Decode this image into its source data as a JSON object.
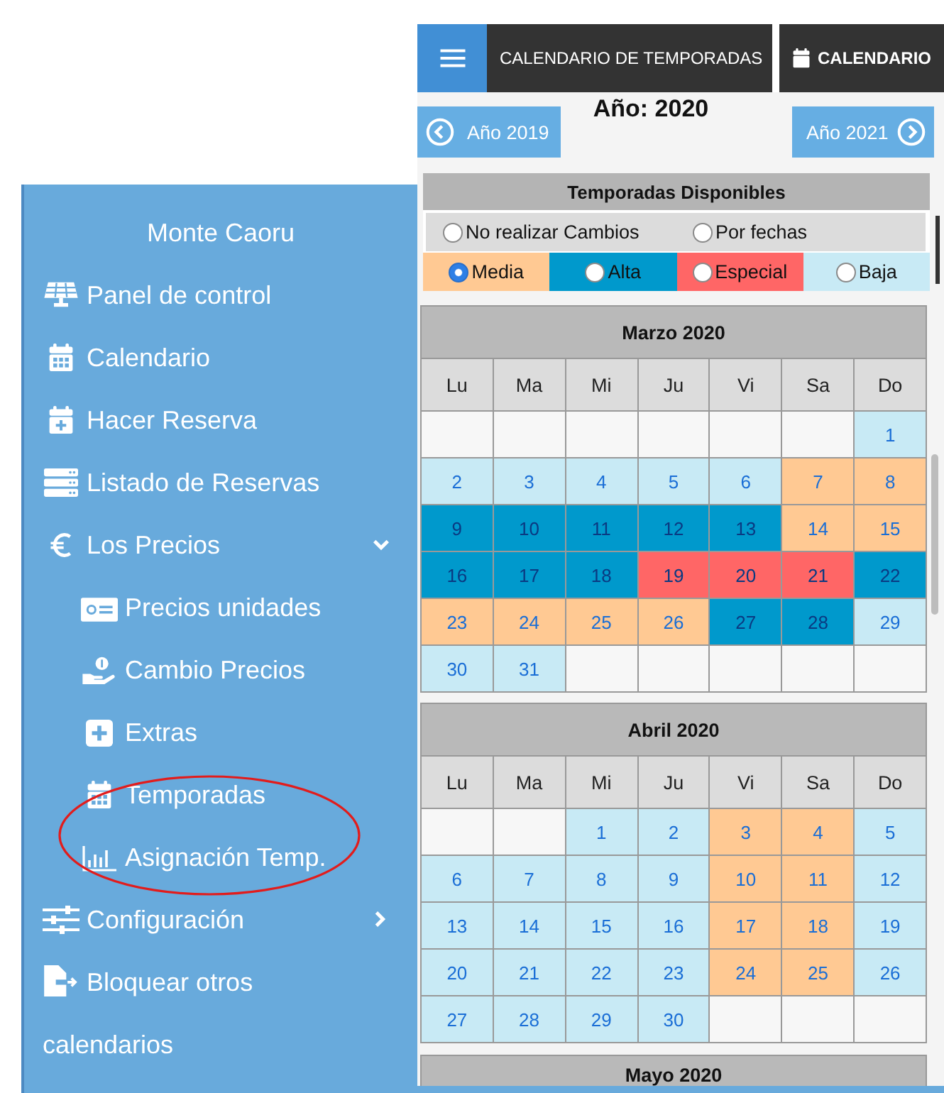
{
  "header": {
    "title": "CALENDARIO DE TEMPORADAS",
    "calendar_button": "CALENDARIO"
  },
  "year_nav": {
    "year": "Año: 2020",
    "previous": "Año 2019",
    "next": "Año 2021"
  },
  "season_panel": {
    "title": "Temporadas Disponibles",
    "modes": [
      {
        "label": "No realizar Cambios",
        "selected": false
      },
      {
        "label": "Por fechas",
        "selected": false
      }
    ],
    "seasons": [
      {
        "label": "Media",
        "color": "#ffc993",
        "selected": true
      },
      {
        "label": "Alta",
        "color": "#0099cc",
        "selected": false
      },
      {
        "label": "Especial",
        "color": "#ff6666",
        "selected": false
      },
      {
        "label": "Baja",
        "color": "#c8eaf5",
        "selected": false
      }
    ]
  },
  "months": [
    {
      "title": "Marzo 2020",
      "weekdays": [
        "Lu",
        "Ma",
        "Mi",
        "Ju",
        "Vi",
        "Sa",
        "Do"
      ],
      "weeks": [
        [
          {
            "kind": "blank"
          },
          {
            "kind": "blank"
          },
          {
            "kind": "blank"
          },
          {
            "kind": "blank"
          },
          {
            "kind": "blank"
          },
          {
            "kind": "blank"
          },
          {
            "kind": "day",
            "day": "1",
            "color": "#c8eaf5"
          }
        ],
        [
          {
            "kind": "day",
            "day": "2",
            "color": "#c8eaf5"
          },
          {
            "kind": "day",
            "day": "3",
            "color": "#c8eaf5"
          },
          {
            "kind": "day",
            "day": "4",
            "color": "#c8eaf5"
          },
          {
            "kind": "day",
            "day": "5",
            "color": "#c8eaf5"
          },
          {
            "kind": "day",
            "day": "6",
            "color": "#c8eaf5"
          },
          {
            "kind": "day",
            "day": "7",
            "color": "#ffc993"
          },
          {
            "kind": "day",
            "day": "8",
            "color": "#ffc993"
          }
        ],
        [
          {
            "kind": "day",
            "day": "9",
            "color": "#0099cc"
          },
          {
            "kind": "day",
            "day": "10",
            "color": "#0099cc"
          },
          {
            "kind": "day",
            "day": "11",
            "color": "#0099cc"
          },
          {
            "kind": "day",
            "day": "12",
            "color": "#0099cc"
          },
          {
            "kind": "day",
            "day": "13",
            "color": "#0099cc"
          },
          {
            "kind": "day",
            "day": "14",
            "color": "#ffc993"
          },
          {
            "kind": "day",
            "day": "15",
            "color": "#ffc993"
          }
        ],
        [
          {
            "kind": "day",
            "day": "16",
            "color": "#0099cc"
          },
          {
            "kind": "day",
            "day": "17",
            "color": "#0099cc"
          },
          {
            "kind": "day",
            "day": "18",
            "color": "#0099cc"
          },
          {
            "kind": "day",
            "day": "19",
            "color": "#ff6666"
          },
          {
            "kind": "day",
            "day": "20",
            "color": "#ff6666"
          },
          {
            "kind": "day",
            "day": "21",
            "color": "#ff6666"
          },
          {
            "kind": "day",
            "day": "22",
            "color": "#0099cc"
          }
        ],
        [
          {
            "kind": "day",
            "day": "23",
            "color": "#ffc993"
          },
          {
            "kind": "day",
            "day": "24",
            "color": "#ffc993"
          },
          {
            "kind": "day",
            "day": "25",
            "color": "#ffc993"
          },
          {
            "kind": "day",
            "day": "26",
            "color": "#ffc993"
          },
          {
            "kind": "day",
            "day": "27",
            "color": "#0099cc"
          },
          {
            "kind": "day",
            "day": "28",
            "color": "#0099cc"
          },
          {
            "kind": "day",
            "day": "29",
            "color": "#c8eaf5"
          }
        ],
        [
          {
            "kind": "day",
            "day": "30",
            "color": "#c8eaf5"
          },
          {
            "kind": "day",
            "day": "31",
            "color": "#c8eaf5"
          },
          {
            "kind": "blank"
          },
          {
            "kind": "blank"
          },
          {
            "kind": "blank"
          },
          {
            "kind": "blank"
          },
          {
            "kind": "blank"
          }
        ]
      ]
    },
    {
      "title": "Abril 2020",
      "weekdays": [
        "Lu",
        "Ma",
        "Mi",
        "Ju",
        "Vi",
        "Sa",
        "Do"
      ],
      "weeks": [
        [
          {
            "kind": "blank"
          },
          {
            "kind": "blank"
          },
          {
            "kind": "day",
            "day": "1",
            "color": "#c8eaf5"
          },
          {
            "kind": "day",
            "day": "2",
            "color": "#c8eaf5"
          },
          {
            "kind": "day",
            "day": "3",
            "color": "#ffc993"
          },
          {
            "kind": "day",
            "day": "4",
            "color": "#ffc993"
          },
          {
            "kind": "day",
            "day": "5",
            "color": "#c8eaf5"
          }
        ],
        [
          {
            "kind": "day",
            "day": "6",
            "color": "#c8eaf5"
          },
          {
            "kind": "day",
            "day": "7",
            "color": "#c8eaf5"
          },
          {
            "kind": "day",
            "day": "8",
            "color": "#c8eaf5"
          },
          {
            "kind": "day",
            "day": "9",
            "color": "#c8eaf5"
          },
          {
            "kind": "day",
            "day": "10",
            "color": "#ffc993"
          },
          {
            "kind": "day",
            "day": "11",
            "color": "#ffc993"
          },
          {
            "kind": "day",
            "day": "12",
            "color": "#c8eaf5"
          }
        ],
        [
          {
            "kind": "day",
            "day": "13",
            "color": "#c8eaf5"
          },
          {
            "kind": "day",
            "day": "14",
            "color": "#c8eaf5"
          },
          {
            "kind": "day",
            "day": "15",
            "color": "#c8eaf5"
          },
          {
            "kind": "day",
            "day": "16",
            "color": "#c8eaf5"
          },
          {
            "kind": "day",
            "day": "17",
            "color": "#ffc993"
          },
          {
            "kind": "day",
            "day": "18",
            "color": "#ffc993"
          },
          {
            "kind": "day",
            "day": "19",
            "color": "#c8eaf5"
          }
        ],
        [
          {
            "kind": "day",
            "day": "20",
            "color": "#c8eaf5"
          },
          {
            "kind": "day",
            "day": "21",
            "color": "#c8eaf5"
          },
          {
            "kind": "day",
            "day": "22",
            "color": "#c8eaf5"
          },
          {
            "kind": "day",
            "day": "23",
            "color": "#c8eaf5"
          },
          {
            "kind": "day",
            "day": "24",
            "color": "#ffc993"
          },
          {
            "kind": "day",
            "day": "25",
            "color": "#ffc993"
          },
          {
            "kind": "day",
            "day": "26",
            "color": "#c8eaf5"
          }
        ],
        [
          {
            "kind": "day",
            "day": "27",
            "color": "#c8eaf5"
          },
          {
            "kind": "day",
            "day": "28",
            "color": "#c8eaf5"
          },
          {
            "kind": "day",
            "day": "29",
            "color": "#c8eaf5"
          },
          {
            "kind": "day",
            "day": "30",
            "color": "#c8eaf5"
          },
          {
            "kind": "blank"
          },
          {
            "kind": "blank"
          },
          {
            "kind": "blank"
          }
        ]
      ]
    },
    {
      "title": "Mayo 2020"
    }
  ],
  "sidebar": {
    "title": "Monte Caoru",
    "items": [
      {
        "label": "Panel de control"
      },
      {
        "label": "Calendario"
      },
      {
        "label": "Hacer Reserva"
      },
      {
        "label": "Listado de Reservas"
      },
      {
        "label": "Los Precios",
        "expanded": true,
        "children": [
          {
            "label": "Precios unidades"
          },
          {
            "label": "Cambio Precios"
          },
          {
            "label": "Extras"
          },
          {
            "label": "Temporadas"
          },
          {
            "label": "Asignación Temp."
          }
        ]
      },
      {
        "label": "Configuración",
        "expanded": false
      },
      {
        "label": "Bloquear otros calendarios"
      }
    ],
    "annotation": {
      "kind": "ellipse"
    }
  }
}
